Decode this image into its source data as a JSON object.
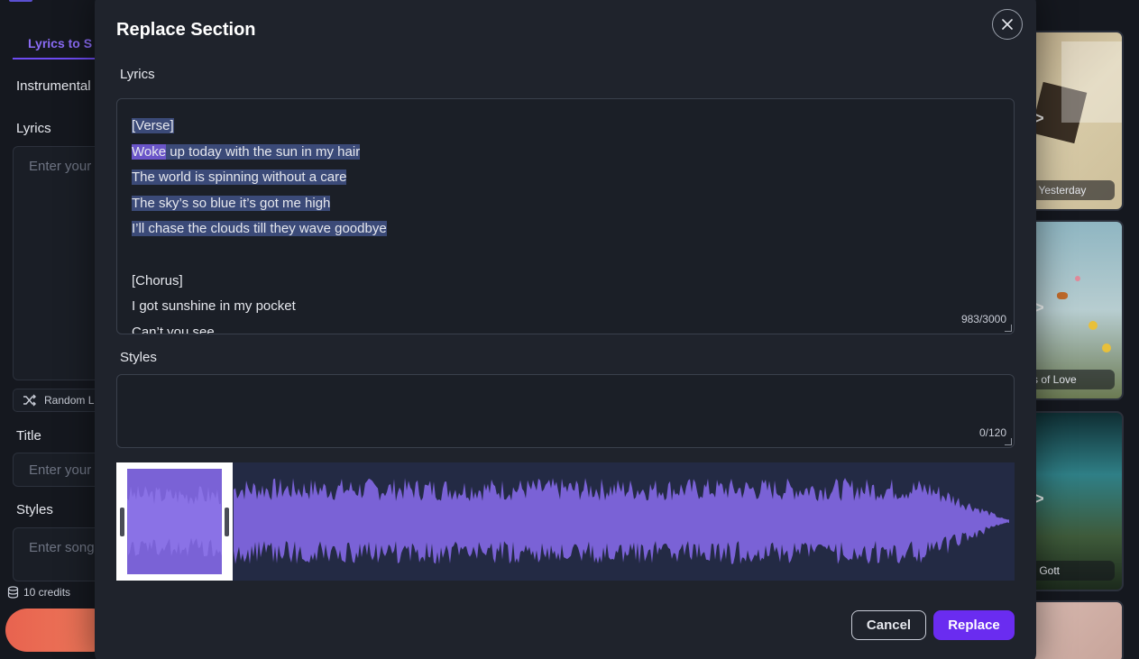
{
  "background": {
    "tab_active": "Lyrics to S",
    "instrumental_label": "Instrumental",
    "lyrics_label": "Lyrics",
    "lyrics_placeholder": "Enter your",
    "random_label": "Random L",
    "title_label": "Title",
    "title_placeholder": "Enter your",
    "styles_label": "Styles",
    "styles_placeholder": "Enter song",
    "credits": "10 credits",
    "cards": [
      {
        "label": "f Yesterday",
        "arrow": ">"
      },
      {
        "label": "s of Love",
        "arrow": ">"
      },
      {
        "label": "r Gott",
        "arrow": ">"
      }
    ]
  },
  "modal": {
    "title": "Replace Section",
    "lyrics_label": "Lyrics",
    "lyrics_counter": "983/3000",
    "styles_label": "Styles",
    "styles_counter": "0/120",
    "cancel_label": "Cancel",
    "replace_label": "Replace"
  },
  "lyrics": {
    "l0": "[Verse]",
    "l1a": "Woke",
    "l1b": " up today with the sun in my hair",
    "l2": "The world is spinning without a care",
    "l3": "The sky’s so blue it’s got me high",
    "l4": "I’ll chase the clouds till they wave goodbye",
    "l5": " ",
    "l6": "[Chorus]",
    "l7": "I got sunshine in my pocket",
    "l8": "Can’t you see"
  },
  "colors": {
    "accent": "#6a2cf0",
    "waveform": "#7a62d6",
    "selection": "#3b4a78"
  }
}
